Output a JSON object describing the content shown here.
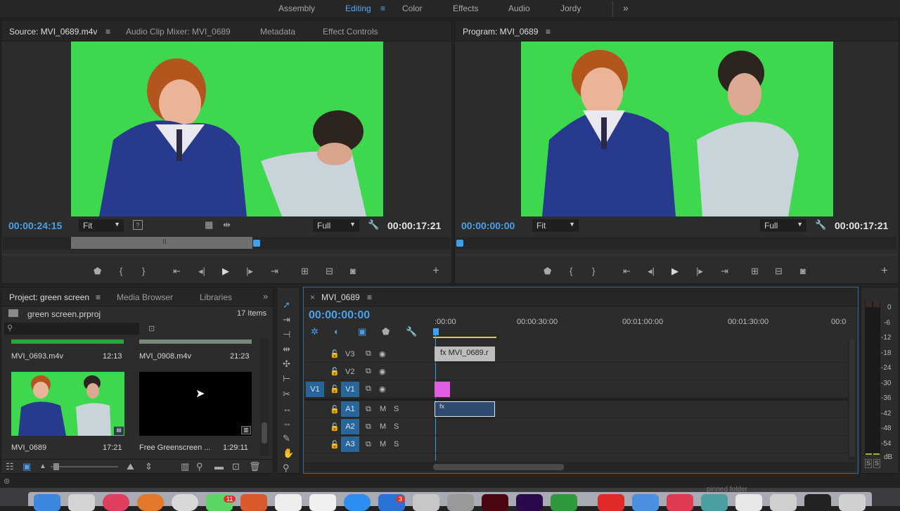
{
  "workspaces": {
    "items": [
      "Assembly",
      "Editing",
      "Color",
      "Effects",
      "Audio",
      "Jordy"
    ],
    "active": "Editing",
    "more_label": "»"
  },
  "source": {
    "tabs": [
      "Source: MVI_0689.m4v",
      "Audio Clip Mixer: MVI_0689",
      "Metadata",
      "Effect Controls"
    ],
    "timecode_left": "00:00:24:15",
    "zoom": "Fit",
    "quality": "Full",
    "timecode_right": "00:00:17:21",
    "playhead_fraction": 0.56
  },
  "program": {
    "tab": "Program: MVI_0689",
    "timecode_left": "00:00:00:00",
    "zoom": "Fit",
    "quality": "Full",
    "timecode_right": "00:00:17:21",
    "playhead_fraction": 0.0
  },
  "project": {
    "tabs": [
      "Project: green screen",
      "Media Browser",
      "Libraries"
    ],
    "file": "green screen.prproj",
    "count": "17 Items",
    "items": [
      {
        "name": "MVI_0693.m4v",
        "duration": "12:13"
      },
      {
        "name": "MVI_0908.m4v",
        "duration": "21:23"
      },
      {
        "name": "MVI_0689",
        "duration": "17:21"
      },
      {
        "name": "Free Greenscreen ...",
        "duration": "1:29:11"
      }
    ]
  },
  "timeline": {
    "sequence": "MVI_0689",
    "timecode": "00:00:00:00",
    "ruler": [
      ":00:00",
      "00:00:30:00",
      "00:01:00:00",
      "00:01:30:00",
      "00:0"
    ],
    "tracks": [
      {
        "name": "V3",
        "kind": "video"
      },
      {
        "name": "V2",
        "kind": "video"
      },
      {
        "name": "V1",
        "kind": "video",
        "source": "V1"
      },
      {
        "name": "A1",
        "kind": "audio"
      },
      {
        "name": "A2",
        "kind": "audio"
      },
      {
        "name": "A3",
        "kind": "audio"
      }
    ],
    "clip_v3": "MVI_0689.r",
    "audio_m": "M",
    "audio_s": "S"
  },
  "meter": {
    "scale": [
      "0",
      "-6",
      "-12",
      "-18",
      "-24",
      "-30",
      "-36",
      "-42",
      "-48",
      "-54",
      "dB"
    ],
    "solo": "S"
  },
  "dock": {
    "badges": [
      "11",
      "3"
    ],
    "pinned_label": "pinned folder"
  }
}
